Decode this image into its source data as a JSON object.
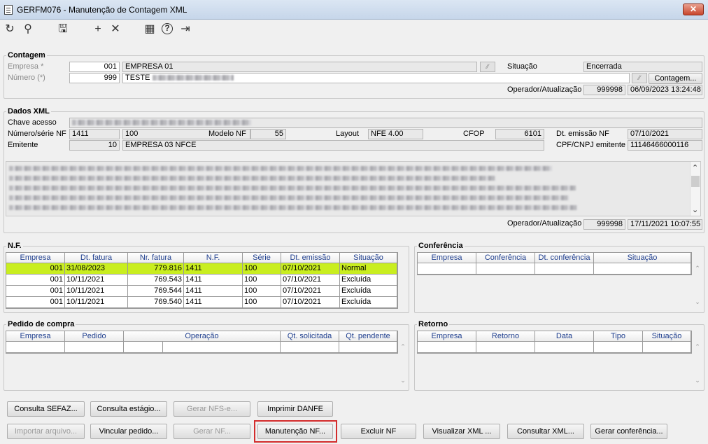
{
  "window": {
    "title": "GERFM076 - Manutenção de Contagem XML",
    "close": "✕"
  },
  "toolbar": [
    {
      "name": "refresh-icon",
      "glyph": "↻"
    },
    {
      "name": "search-icon",
      "glyph": "⚲"
    },
    {
      "name": "save-icon",
      "glyph": "🖫"
    },
    {
      "name": "add-icon",
      "glyph": "+"
    },
    {
      "name": "delete-icon",
      "glyph": "✕"
    },
    {
      "name": "calendar-icon",
      "glyph": "▦"
    },
    {
      "name": "help-icon",
      "glyph": "?"
    },
    {
      "name": "exit-icon",
      "glyph": "⇥"
    }
  ],
  "contagem": {
    "legend": "Contagem",
    "empresa_label": "Empresa *",
    "empresa_code": "001",
    "empresa_name": "EMPRESA 01",
    "numero_label": "Número (*)",
    "numero": "999",
    "numero_desc": "TESTE",
    "situacao_label": "Situação",
    "situacao": "Encerrada",
    "contagem_btn": "Contagem...",
    "operador_label": "Operador/Atualização",
    "operador": "999998",
    "atualizacao": "06/09/2023 13:24:48",
    "lookup_glyph": "⁄⁄"
  },
  "dados_xml": {
    "legend": "Dados XML",
    "chave_label": "Chave acesso",
    "numero_serie_label": "Número/série NF",
    "numero_nf": "1411",
    "serie": "100",
    "modelo_label": "Modelo NF",
    "modelo": "55",
    "layout_label": "Layout",
    "layout": "NFE 4.00",
    "cfop_label": "CFOP",
    "cfop": "6101",
    "dt_emissao_label": "Dt. emissão NF",
    "dt_emissao": "07/10/2021",
    "emitente_label": "Emitente",
    "emitente_code": "10",
    "emitente_name": "EMPRESA 03 NFCE",
    "cpf_label": "CPF/CNPJ emitente",
    "cpf": "11146466000116",
    "operador_label": "Operador/Atualização",
    "operador": "999998",
    "atualizacao": "17/11/2021 10:07:55"
  },
  "nf": {
    "legend": "N.F.",
    "columns": [
      "Empresa",
      "Dt. fatura",
      "Nr. fatura",
      "N.F.",
      "Série",
      "Dt. emissão",
      "Situação"
    ],
    "rows": [
      [
        "001",
        "31/08/2023",
        "779.816",
        "1411",
        "100",
        "07/10/2021",
        "Normal"
      ],
      [
        "001",
        "10/11/2021",
        "769.543",
        "1411",
        "100",
        "07/10/2021",
        "Excluída"
      ],
      [
        "001",
        "10/11/2021",
        "769.544",
        "1411",
        "100",
        "07/10/2021",
        "Excluída"
      ],
      [
        "001",
        "10/11/2021",
        "769.540",
        "1411",
        "100",
        "07/10/2021",
        "Excluída"
      ]
    ]
  },
  "conferencia": {
    "legend": "Conferência",
    "columns": [
      "Empresa",
      "Conferência",
      "Dt. conferência",
      "Situação"
    ]
  },
  "pedido": {
    "legend": "Pedido de compra",
    "columns": [
      "Empresa",
      "Pedido",
      "Operação",
      "Qt. solicitada",
      "Qt. pendente"
    ]
  },
  "retorno": {
    "legend": "Retorno",
    "columns": [
      "Empresa",
      "Retorno",
      "Data",
      "Tipo",
      "Situação"
    ]
  },
  "buttons": {
    "consulta_sefaz": "Consulta SEFAZ...",
    "consulta_estagio": "Consulta estágio...",
    "gerar_nfse": "Gerar NFS-e...",
    "imprimir_danfe": "Imprimir DANFE",
    "importar": "Importar arquivo...",
    "vincular": "Vincular pedido...",
    "gerar_nf": "Gerar NF...",
    "manutencao": "Manutenção NF...",
    "excluir": "Excluir NF",
    "visualizar": "Visualizar XML ...",
    "consultar_xml": "Consultar XML...",
    "gerar_conferencia": "Gerar conferência..."
  },
  "scroll": {
    "up": "⌃",
    "down": "⌄"
  }
}
